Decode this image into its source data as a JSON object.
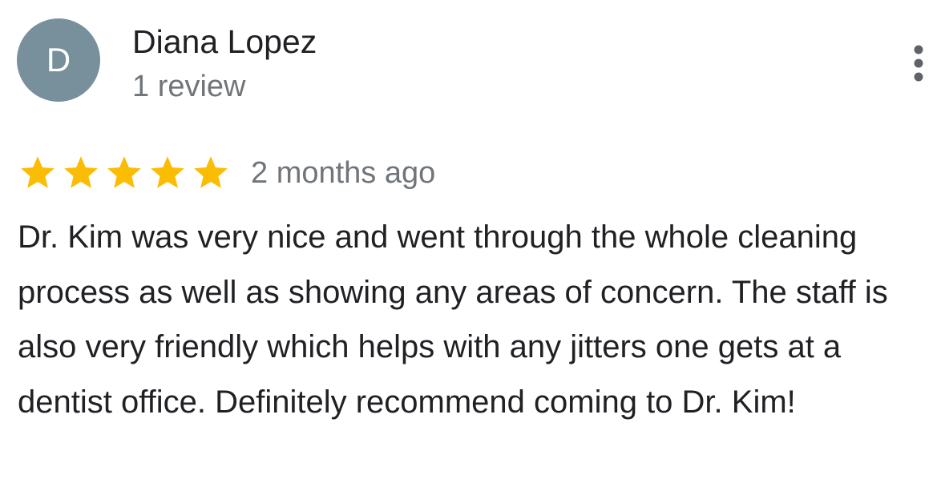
{
  "review": {
    "author": {
      "avatar_letter": "D",
      "avatar_color": "#78909c",
      "name": "Diana Lopez",
      "review_count": "1 review"
    },
    "more_options_icon": "more-vert-icon",
    "rating": {
      "stars": 5,
      "max_stars": 5,
      "star_color": "#fbbc04",
      "icon": "star-icon"
    },
    "date": "2 months ago",
    "text": "Dr. Kim was very nice and went through the whole cleaning process as well as showing any areas of concern. The staff is also very friendly which helps with any jitters one gets at a dentist office. Definitely recommend coming to Dr. Kim!"
  }
}
